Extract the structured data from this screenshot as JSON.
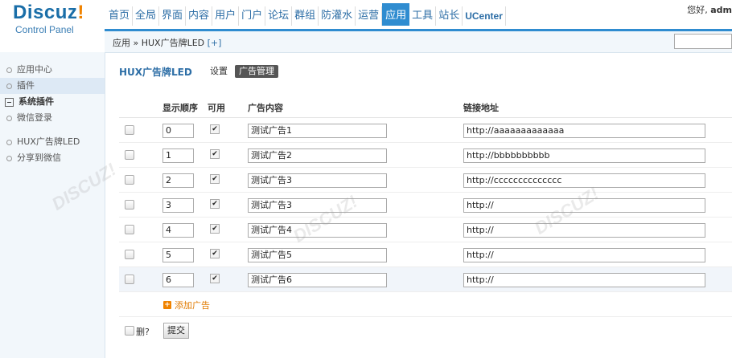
{
  "logo": {
    "brand": "Discuz",
    "bang": "!",
    "sub": "Control Panel"
  },
  "nav": {
    "items": [
      "首页",
      "全局",
      "界面",
      "内容",
      "用户",
      "门户",
      "论坛",
      "群组",
      "防灌水",
      "运营",
      "应用",
      "工具",
      "站长",
      "UCenter"
    ],
    "active": "应用"
  },
  "user": {
    "greeting": "您好, ",
    "name": "adm"
  },
  "breadcrumb": {
    "path": "应用 » HUX广告牌LED",
    "add": "[+]"
  },
  "sidebar": {
    "items": [
      {
        "label": "应用中心"
      },
      {
        "label": "插件"
      }
    ],
    "group": "系统插件",
    "group_items": [
      {
        "label": "微信登录"
      }
    ],
    "plugins": [
      {
        "label": "HUX广告牌LED"
      },
      {
        "label": "分享到微信"
      }
    ]
  },
  "page": {
    "title": "HUX广告牌LED",
    "tab_settings": "设置",
    "tab_manage": "广告管理"
  },
  "table": {
    "headers": {
      "order": "显示顺序",
      "enabled": "可用",
      "content": "广告内容",
      "link": "链接地址"
    },
    "rows": [
      {
        "order": "0",
        "enabled": true,
        "content": "测试广告1",
        "link": "http://aaaaaaaaaaaaa"
      },
      {
        "order": "1",
        "enabled": true,
        "content": "测试广告2",
        "link": "http://bbbbbbbbbb"
      },
      {
        "order": "2",
        "enabled": true,
        "content": "测试广告3",
        "link": "http://cccccccccccccc"
      },
      {
        "order": "3",
        "enabled": true,
        "content": "测试广告3",
        "link": "http://"
      },
      {
        "order": "4",
        "enabled": true,
        "content": "测试广告4",
        "link": "http://"
      },
      {
        "order": "5",
        "enabled": true,
        "content": "测试广告5",
        "link": "http://"
      },
      {
        "order": "6",
        "enabled": true,
        "content": "测试广告6",
        "link": "http://"
      }
    ],
    "add_label": "添加广告",
    "add_icon": "plus-icon",
    "delete_label": "删?",
    "submit_label": "提交"
  },
  "colors": {
    "accent": "#2f8cd0",
    "brand": "#1a6ea8",
    "orange": "#f08300"
  }
}
